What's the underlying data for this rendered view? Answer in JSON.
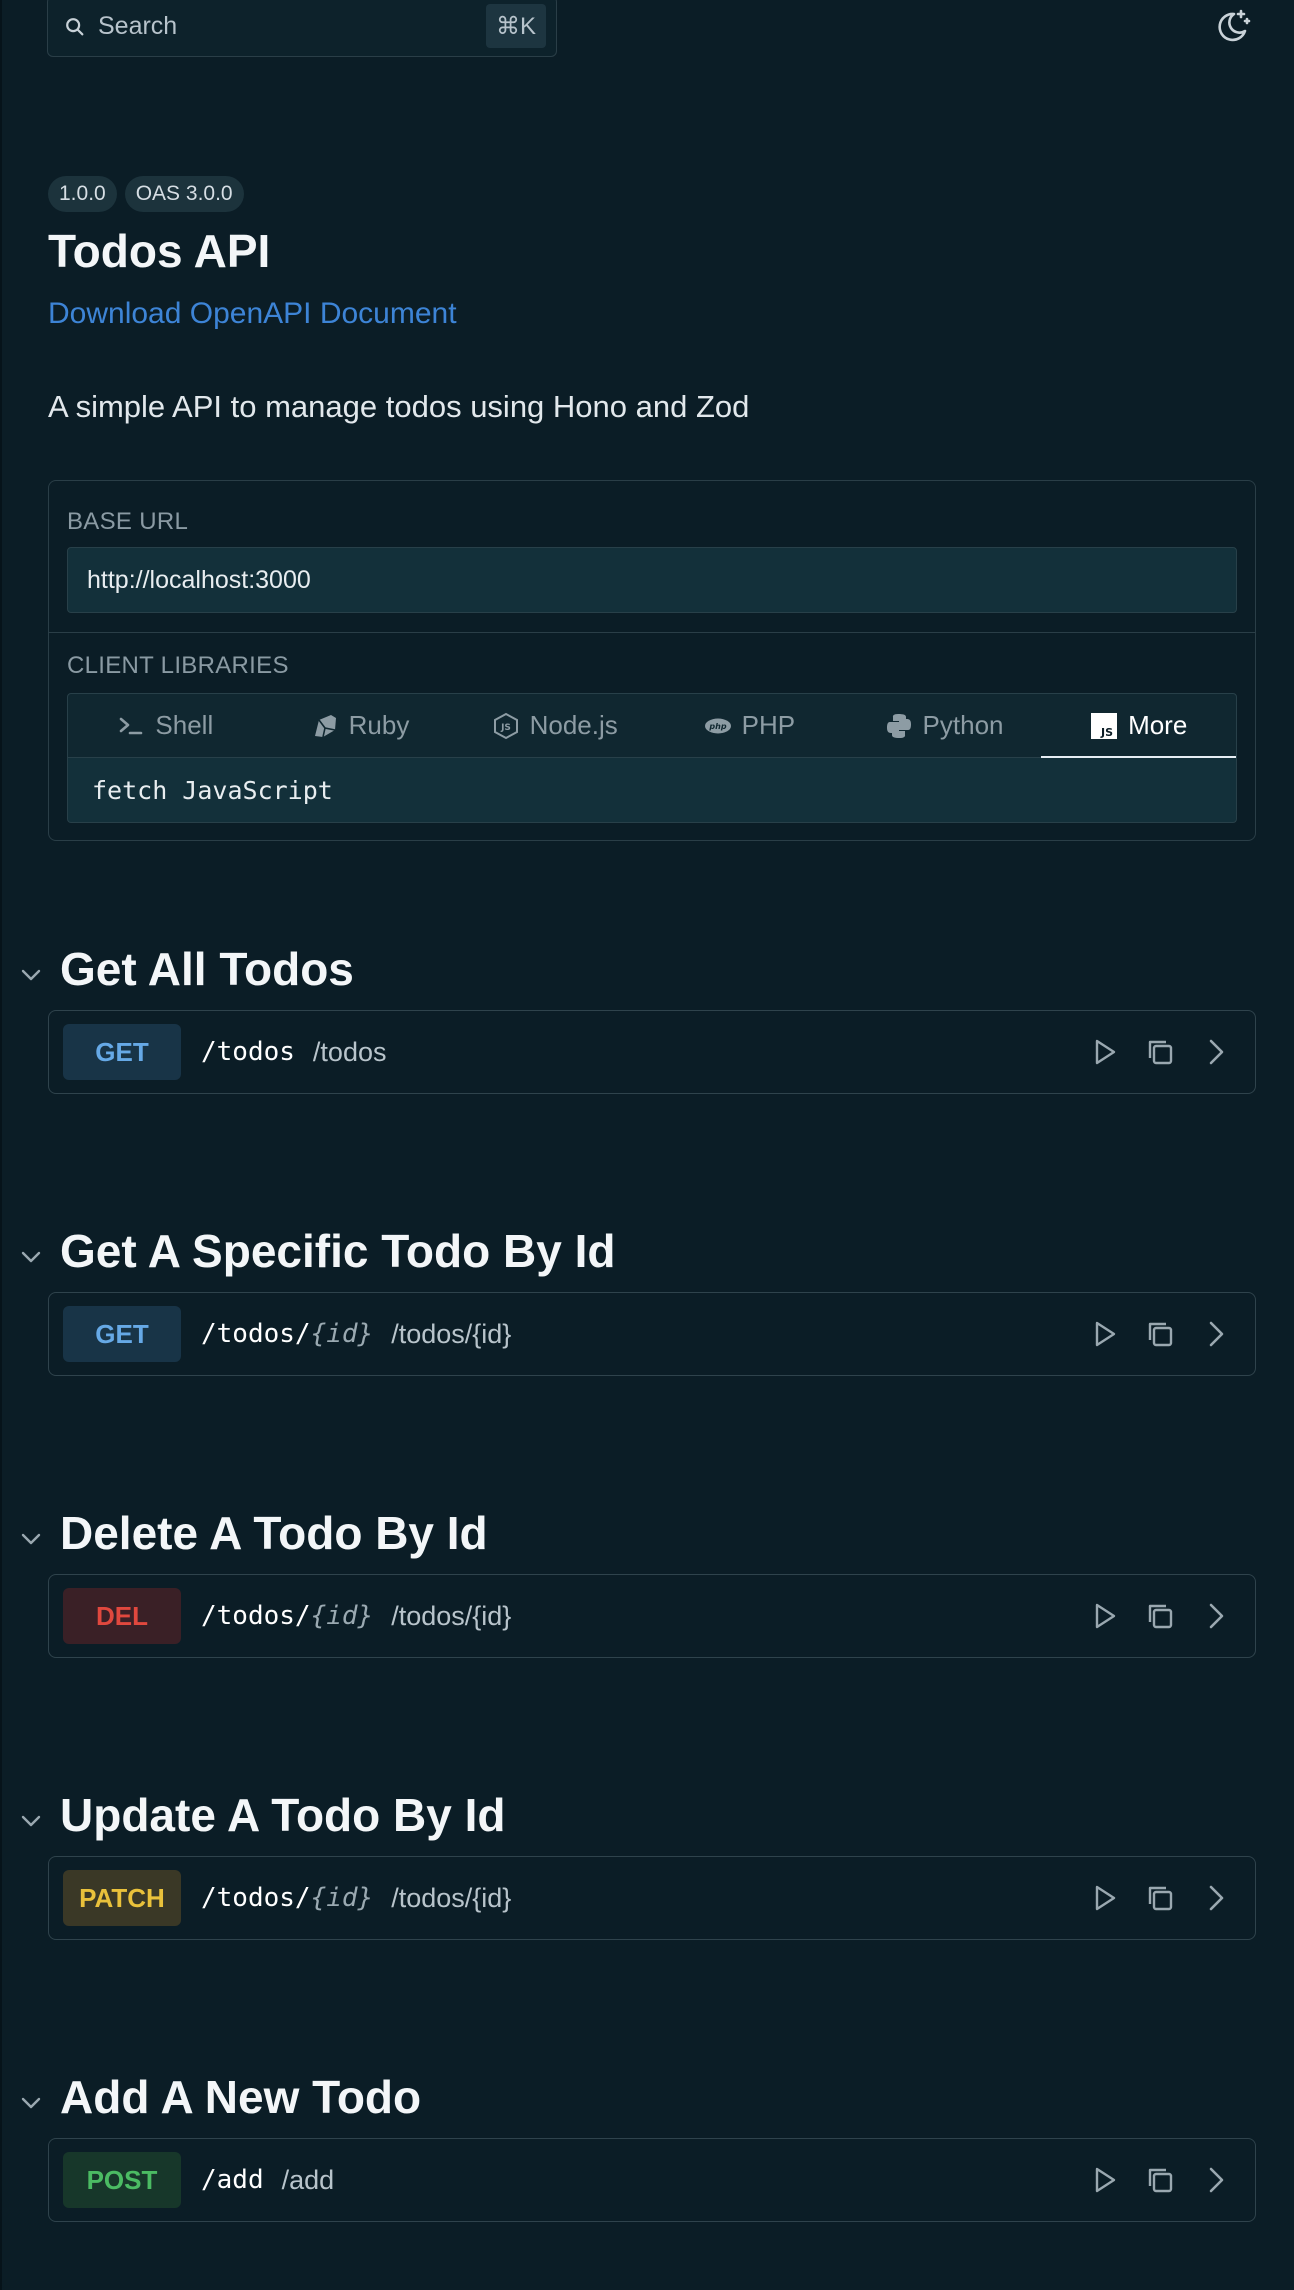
{
  "search": {
    "placeholder": "Search",
    "shortcut": "⌘K"
  },
  "header": {
    "version_badge": "1.0.0",
    "spec_badge": "OAS 3.0.0",
    "title": "Todos API",
    "download_link": "Download OpenAPI Document",
    "description": "A simple API to manage todos using Hono and Zod"
  },
  "base_url": {
    "label": "BASE URL",
    "value": "http://localhost:3000"
  },
  "client_libraries": {
    "label": "CLIENT LIBRARIES",
    "tabs": [
      {
        "label": "Shell",
        "icon": "terminal-icon"
      },
      {
        "label": "Ruby",
        "icon": "ruby-icon"
      },
      {
        "label": "Node.js",
        "icon": "nodejs-icon"
      },
      {
        "label": "PHP",
        "icon": "php-icon"
      },
      {
        "label": "Python",
        "icon": "python-icon"
      },
      {
        "label": "More",
        "icon": "javascript-icon",
        "active": true
      }
    ],
    "code_label": "fetch JavaScript"
  },
  "sections": [
    {
      "title": "Get All Todos",
      "method": "GET",
      "path_base": "/todos",
      "path_param": "",
      "display_path": "/todos"
    },
    {
      "title": "Get A Specific Todo By Id",
      "method": "GET",
      "path_base": "/todos/",
      "path_param": "{id}",
      "display_path": "/todos/{id}"
    },
    {
      "title": "Delete A Todo By Id",
      "method": "DEL",
      "path_base": "/todos/",
      "path_param": "{id}",
      "display_path": "/todos/{id}"
    },
    {
      "title": "Update A Todo By Id",
      "method": "PATCH",
      "path_base": "/todos/",
      "path_param": "{id}",
      "display_path": "/todos/{id}"
    },
    {
      "title": "Add A New Todo",
      "method": "POST",
      "path_base": "/add",
      "path_param": "",
      "display_path": "/add"
    }
  ],
  "colors": {
    "background": "#0b1d26",
    "link": "#3d84d6",
    "get": "#66a9e6",
    "delete": "#e0483e",
    "patch": "#e9c13b",
    "post": "#4bbb63"
  }
}
